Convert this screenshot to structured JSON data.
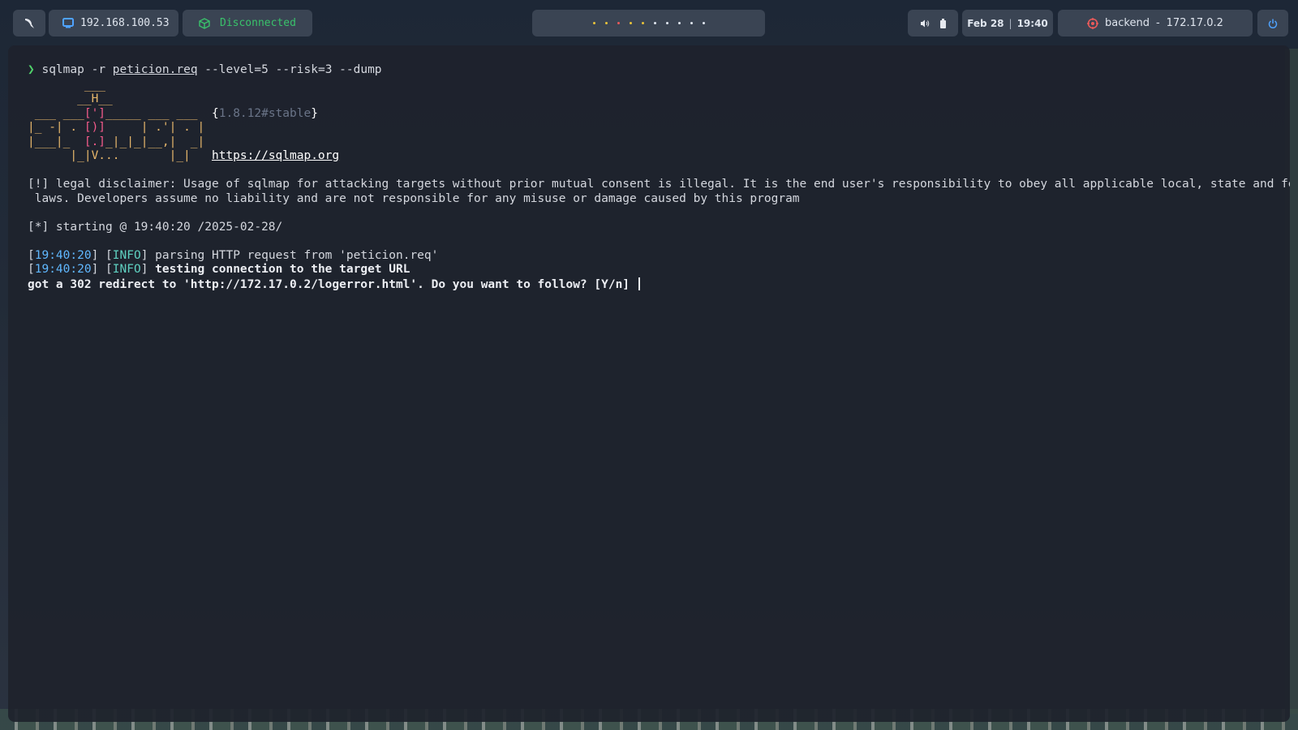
{
  "topbar": {
    "ip": "192.168.100.53",
    "vpn_status": "Disconnected",
    "date": "Feb 28",
    "time": "19:40",
    "target_name": "backend",
    "target_sep": "-",
    "target_ip": "172.17.0.2",
    "workspaces": [
      "active",
      "active",
      "urgent",
      "active",
      "active",
      "idle",
      "idle",
      "idle",
      "idle",
      "idle"
    ]
  },
  "terminal": {
    "prompt_symbol": "❯",
    "cmd_name": "sqlmap",
    "cmd_flag_r": "-r",
    "cmd_file": "peticion.req",
    "cmd_rest": "--level=5 --risk=3 --dump",
    "banner_lines": [
      "        ___",
      "       __H__",
      " ___ ___[']_____ ___ ___  {1.8.12#stable}",
      "|_ -| . [)]     | .'| . |",
      "|___|_  [.]_|_|_|__,|  _|",
      "      |_|V...       |_|   https://sqlmap.org"
    ],
    "version": "1.8.12#stable",
    "url": "https://sqlmap.org",
    "disclaimer_1": "[!] legal disclaimer: Usage of sqlmap for attacking targets without prior mutual consent is illegal. It is the end user's responsibility to obey all applicable local, state and federal",
    "disclaimer_2": " laws. Developers assume no liability and are not responsible for any misuse or damage caused by this program",
    "starting": "[*] starting @ 19:40:20 /2025-02-28/",
    "log": [
      {
        "time": "19:40:20",
        "level": "INFO",
        "msg": "parsing HTTP request from 'peticion.req'",
        "bold": false
      },
      {
        "time": "19:40:20",
        "level": "INFO",
        "msg": "testing connection to the target URL",
        "bold": true
      }
    ],
    "question": "got a 302 redirect to 'http://172.17.0.2/logerror.html'. Do you want to follow? [Y/n]"
  },
  "colors": {
    "accent_green": "#50d26a",
    "vpn_green": "#39c26b",
    "timestamp_blue": "#60b8ff",
    "info_cyan": "#5fd0c0",
    "banner_orange": "#e6b66b",
    "banner_pink": "#f25a8a",
    "target_red": "#e85a5a"
  }
}
